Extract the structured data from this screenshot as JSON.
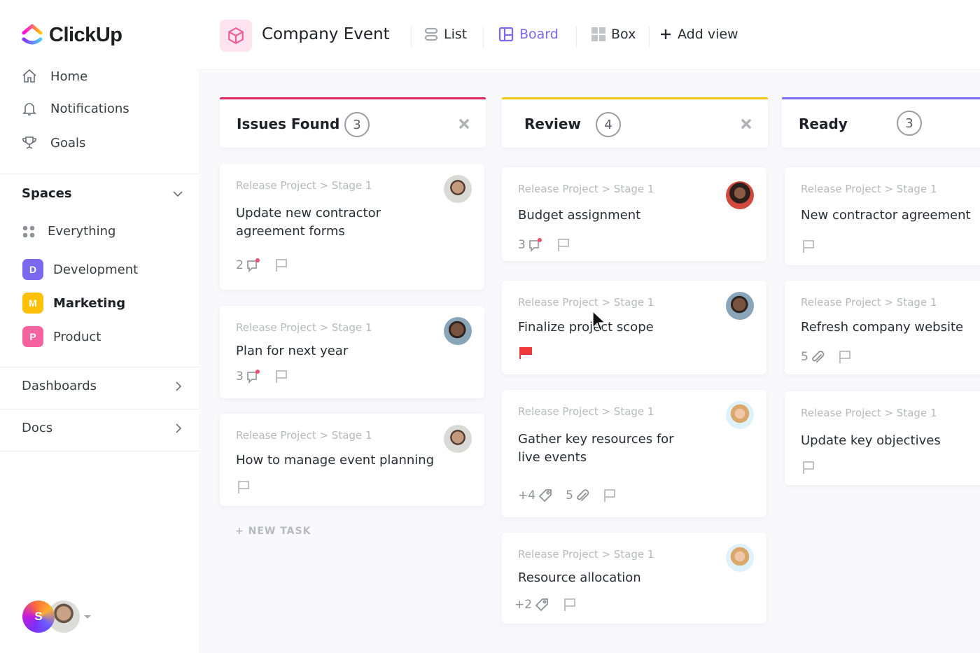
{
  "brand": {
    "name": "ClickUp"
  },
  "sidebar": {
    "nav": [
      {
        "label": "Home",
        "icon": "home-icon"
      },
      {
        "label": "Notifications",
        "icon": "bell-icon"
      },
      {
        "label": "Goals",
        "icon": "trophy-icon"
      }
    ],
    "spaces_label": "Spaces",
    "everything_label": "Everything",
    "spaces": [
      {
        "label": "Development",
        "letter": "D",
        "color": "#7b68ee"
      },
      {
        "label": "Marketing",
        "letter": "M",
        "color": "#ffc107"
      },
      {
        "label": "Product",
        "letter": "P",
        "color": "#f562a0"
      }
    ],
    "sections": [
      {
        "label": "Dashboards"
      },
      {
        "label": "Docs"
      }
    ],
    "user_initial": "S"
  },
  "topbar": {
    "project_title": "Company Event",
    "tabs": [
      {
        "label": "List",
        "icon": "list-icon",
        "active": false
      },
      {
        "label": "Board",
        "icon": "board-icon",
        "active": true
      },
      {
        "label": "Box",
        "icon": "box-icon",
        "active": false
      }
    ],
    "add_view_label": "Add view"
  },
  "colors": {
    "accent": "#7b68ee",
    "issues": "#e0245e",
    "review": "#f5c51b",
    "ready": "#7b68ee",
    "priority_flag": "#f0383b",
    "notification_dot": "#f04f74"
  },
  "board": {
    "new_task_label": "+ NEW TASK",
    "columns": [
      {
        "title": "Issues Found",
        "count": "3",
        "cards": [
          {
            "path": "Release Project > Stage 1",
            "title": "Update new contractor agreement forms",
            "comments": "2"
          },
          {
            "path": "Release Project > Stage 1",
            "title": "Plan for next year",
            "comments": "3"
          },
          {
            "path": "Release Project > Stage 1",
            "title": "How to manage event planning"
          }
        ]
      },
      {
        "title": "Review",
        "count": "4",
        "cards": [
          {
            "path": "Release Project > Stage 1",
            "title": "Budget assignment",
            "comments": "3"
          },
          {
            "path": "Release Project > Stage 1",
            "title": "Finalize project scope",
            "priority": "urgent"
          },
          {
            "path": "Release Project > Stage 1",
            "title": "Gather key resources for live events",
            "tags": "+4",
            "attachments": "5"
          },
          {
            "path": "Release Project > Stage 1",
            "title": "Resource allocation",
            "tags": "+2"
          }
        ]
      },
      {
        "title": "Ready",
        "count": "3",
        "cards": [
          {
            "path": "Release Project > Stage 1",
            "title": "New contractor agreement"
          },
          {
            "path": "Release Project > Stage 1",
            "title": "Refresh company website",
            "attachments": "5"
          },
          {
            "path": "Release Project > Stage 1",
            "title": "Update key objectives"
          }
        ]
      }
    ]
  }
}
